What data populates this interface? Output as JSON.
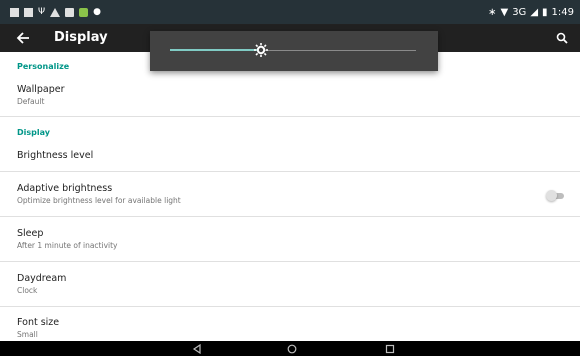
{
  "status_bar": {
    "network": "3G",
    "time": "1:49"
  },
  "app_bar": {
    "title": "Display"
  },
  "sections": {
    "personalize": "Personalize",
    "display": "Display"
  },
  "prefs": {
    "wallpaper": {
      "title": "Wallpaper",
      "summary": "Default"
    },
    "brightness": {
      "title": "Brightness level"
    },
    "adaptive": {
      "title": "Adaptive brightness",
      "summary": "Optimize brightness level for available light",
      "enabled": false
    },
    "sleep": {
      "title": "Sleep",
      "summary": "After 1 minute of inactivity"
    },
    "daydream": {
      "title": "Daydream",
      "summary": "Clock"
    },
    "font_size": {
      "title": "Font size",
      "summary": "Small"
    }
  },
  "brightness_dialog": {
    "level": 0.37
  },
  "colors": {
    "accent": "#009688",
    "app_bar": "#212121",
    "status_bar": "#263238",
    "slider_fill": "#80cbc4"
  },
  "icons": {
    "back": "arrow-left-icon",
    "search": "search-icon",
    "brightness": "brightness-icon",
    "nav_back": "triangle-back-icon",
    "nav_home": "circle-home-icon",
    "nav_recents": "square-recents-icon"
  }
}
